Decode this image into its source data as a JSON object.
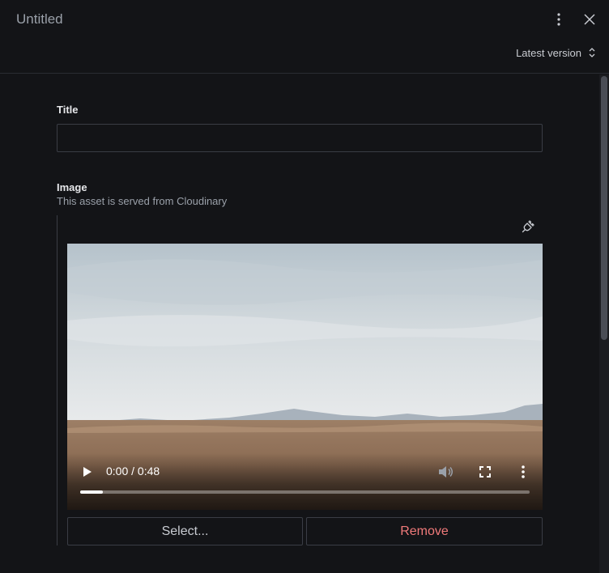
{
  "header": {
    "title": "Untitled",
    "version_label": "Latest version",
    "icons": {
      "menu": "dots-vertical-icon",
      "close": "close-icon",
      "version": "chevron-up-down-icon"
    }
  },
  "form": {
    "title_field": {
      "label": "Title",
      "value": ""
    },
    "image_field": {
      "label": "Image",
      "description": "This asset is served from Cloudinary",
      "plugin_icon": "plug-icon"
    }
  },
  "video": {
    "time": "0:00 / 0:48",
    "progress": 0.05,
    "icons": {
      "play": "play-icon",
      "mute": "volume-icon",
      "fullscreen": "fullscreen-icon",
      "more": "dots-vertical-icon"
    }
  },
  "actions": {
    "select_label": "Select...",
    "remove_label": "Remove"
  },
  "colors": {
    "background": "#131417",
    "border": "#3a3d45",
    "danger": "#f07a7a"
  }
}
